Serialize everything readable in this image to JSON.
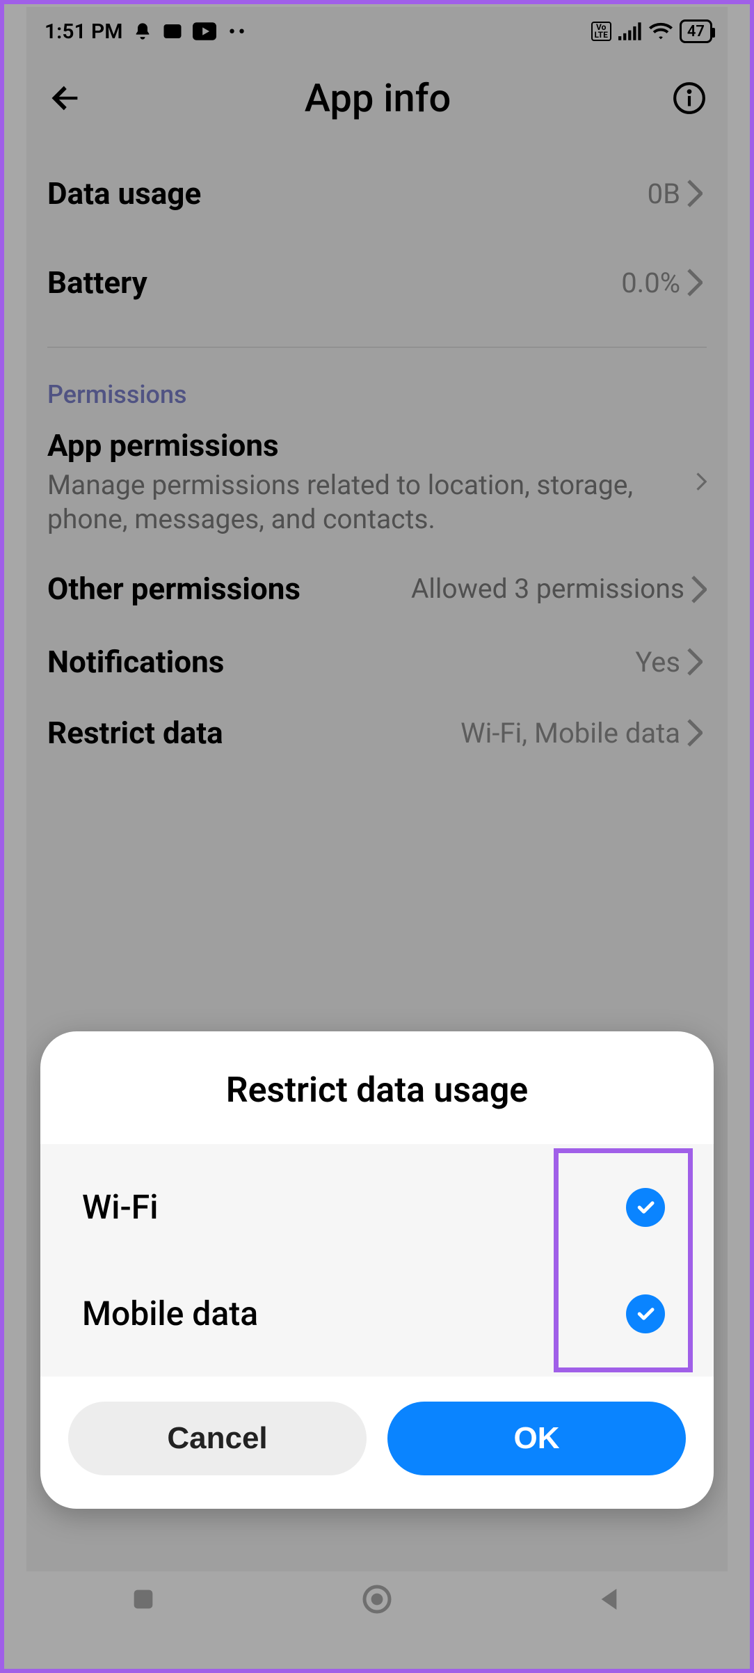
{
  "status": {
    "time": "1:51 PM",
    "battery_text": "47"
  },
  "header": {
    "title": "App info"
  },
  "rows": {
    "data_usage": {
      "label": "Data usage",
      "value": "0B"
    },
    "battery": {
      "label": "Battery",
      "value": "0.0%"
    }
  },
  "section": {
    "permissions_header": "Permissions",
    "app_permissions": {
      "label": "App permissions",
      "sub": "Manage permissions related to location, storage, phone, messages, and contacts."
    },
    "other_permissions": {
      "label": "Other permissions",
      "value": "Allowed 3 permissions"
    },
    "notifications": {
      "label": "Notifications",
      "value": "Yes"
    },
    "restrict_data": {
      "label": "Restrict data",
      "value": "Wi-Fi, Mobile data"
    }
  },
  "dialog": {
    "title": "Restrict data usage",
    "options": {
      "wifi": {
        "label": "Wi-Fi",
        "checked": true
      },
      "mobile": {
        "label": "Mobile data",
        "checked": true
      }
    },
    "cancel": "Cancel",
    "ok": "OK"
  }
}
